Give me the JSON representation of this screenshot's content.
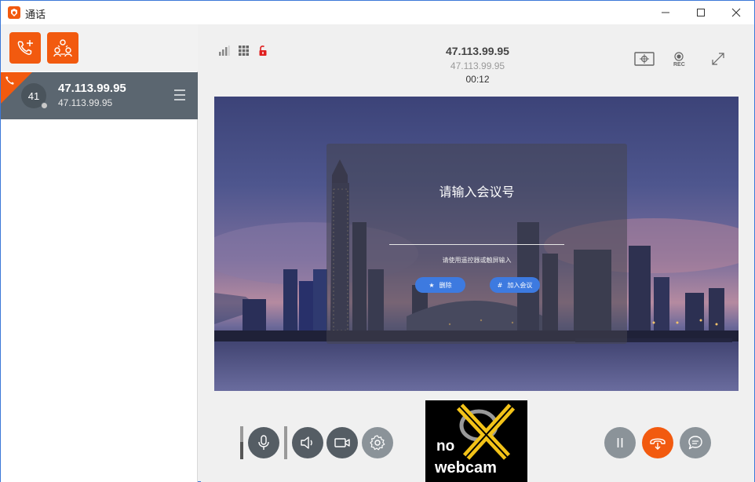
{
  "window": {
    "title": "通话",
    "accent": "#f25a0f"
  },
  "left_panel": {
    "toolbar": {
      "add_call_icon": "phone-plus-icon",
      "conference_icon": "group-conference-icon"
    },
    "calls": [
      {
        "avatar_text": "41",
        "name": "47.113.99.95",
        "subtitle": "47.113.99.95",
        "status": "offline-dot"
      }
    ]
  },
  "call_header": {
    "remote_name": "47.113.99.95",
    "remote_address": "47.113.99.95",
    "duration": "00:12",
    "rec_label": "REC"
  },
  "conference_dialog": {
    "title": "请输入会议号",
    "hint": "请使用遥控器或触屏输入",
    "delete_label": "删除",
    "delete_glyph": "★",
    "join_label": "加入会议",
    "join_glyph": "#"
  },
  "controls": {
    "mic": "microphone-icon",
    "speaker": "speaker-icon",
    "camera": "video-camera-icon",
    "settings": "gear-icon",
    "pause": "pause-icon",
    "hangup": "hangup-icon",
    "chat": "chat-icon"
  },
  "self_view": {
    "line1": "no",
    "line2": "webcam"
  }
}
